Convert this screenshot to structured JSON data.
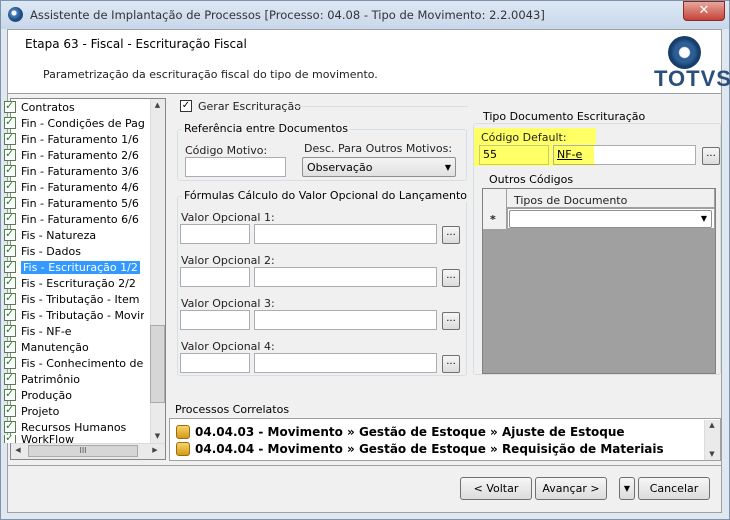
{
  "window": {
    "title": "Assistente de Implantação de Processos [Processo: 04.08 - Tipo de Movimento: 2.2.0043]",
    "close_glyph": "✕"
  },
  "header": {
    "step_title": "Etapa 63 - Fiscal - Escrituração Fiscal",
    "step_description": "Parametrização da escrituração fiscal do tipo de movimento.",
    "logo_text": "TOTVS"
  },
  "sidebar": {
    "items": [
      {
        "label": "Contratos"
      },
      {
        "label": "Fin - Condições de Paga"
      },
      {
        "label": "Fin - Faturamento 1/6"
      },
      {
        "label": "Fin - Faturamento 2/6"
      },
      {
        "label": "Fin - Faturamento 3/6"
      },
      {
        "label": "Fin - Faturamento 4/6"
      },
      {
        "label": "Fin - Faturamento 5/6"
      },
      {
        "label": "Fin - Faturamento 6/6"
      },
      {
        "label": "Fis - Natureza"
      },
      {
        "label": "Fis - Dados"
      },
      {
        "label": "Fis - Escrituração 1/2"
      },
      {
        "label": "Fis - Escrituração 2/2"
      },
      {
        "label": "Fis - Tributação - Item"
      },
      {
        "label": "Fis - Tributação - Movim"
      },
      {
        "label": "Fis - NF-e"
      },
      {
        "label": "Manutenção"
      },
      {
        "label": "Fis - Conhecimento de T"
      },
      {
        "label": "Patrimônio"
      },
      {
        "label": "Produção"
      },
      {
        "label": "Projeto"
      },
      {
        "label": "Recursos Humanos"
      },
      {
        "label": "WorkFlow"
      }
    ],
    "selected_index": 10,
    "hscroll_glyph": "III"
  },
  "form": {
    "gerar_escrituracao_label": "Gerar Escrituração",
    "gerar_escrituracao_checked": "✓",
    "referencia": {
      "title": "Referência entre Documentos",
      "codigo_motivo_label": "Código Motivo:",
      "codigo_motivo_value": "",
      "desc_label": "Desc. Para Outros Motivos:",
      "desc_value": "Observação"
    },
    "formulas": {
      "title": "Fórmulas Cálculo do Valor Opcional do Lançamento",
      "valor1_label": "Valor Opcional 1:",
      "valor2_label": "Valor Opcional 2:",
      "valor3_label": "Valor Opcional 3:",
      "valor4_label": "Valor Opcional 4:"
    },
    "tipo_documento": {
      "title": "Tipo Documento Escrituração",
      "codigo_default_label": "Código Default:",
      "codigo_value": "55",
      "codigo_desc": "NF-e"
    },
    "outros_codigos": {
      "title": "Outros Códigos",
      "column_header": "Tipos de Documento",
      "new_row_marker": "*"
    },
    "ellipsis": "..."
  },
  "related": {
    "title": "Processos Correlatos",
    "items": [
      {
        "label": "04.04.03 - Movimento » Gestão de Estoque » Ajuste de Estoque"
      },
      {
        "label": "04.04.04 - Movimento » Gestão de Estoque » Requisição de Materiais"
      }
    ]
  },
  "footer": {
    "back_label": "< Voltar",
    "next_label": "Avançar >",
    "cancel_label": "Cancelar",
    "menu_glyph": "▼"
  },
  "colors": {
    "highlight": "#ffff66",
    "selection": "#3399ff",
    "logo": "#2b4f7c"
  }
}
